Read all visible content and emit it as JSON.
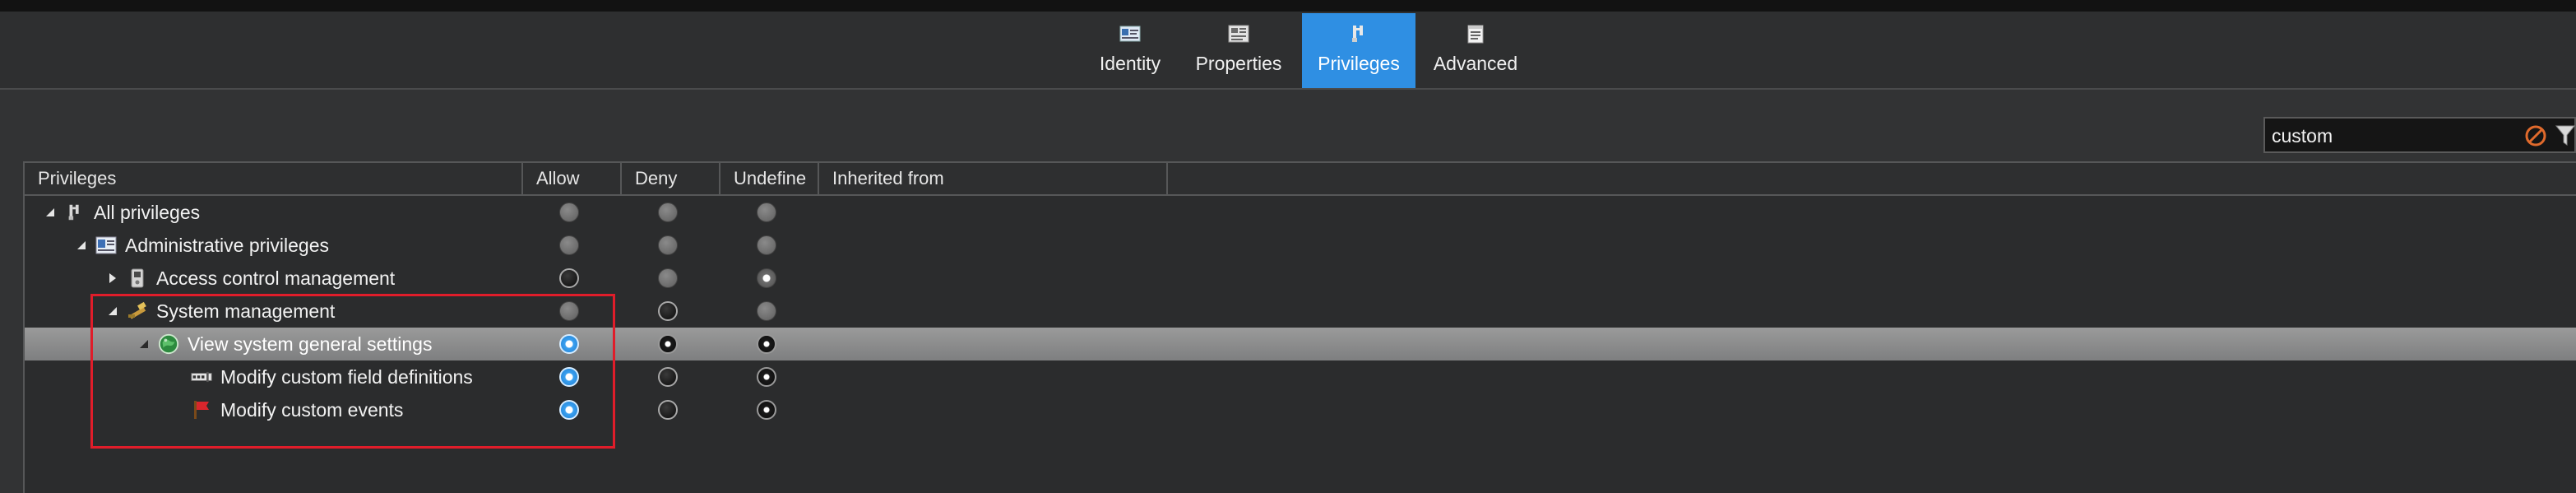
{
  "tabs": [
    {
      "label": "Identity",
      "icon": "id-card-icon",
      "active": false
    },
    {
      "label": "Properties",
      "icon": "properties-icon",
      "active": false
    },
    {
      "label": "Privileges",
      "icon": "privileges-icon",
      "active": true
    },
    {
      "label": "Advanced",
      "icon": "notepad-icon",
      "active": false
    }
  ],
  "search": {
    "value": "custom"
  },
  "columns": [
    "Privileges",
    "Allow",
    "Deny",
    "Undefine",
    "Inherited from"
  ],
  "rows": [
    {
      "label": "All privileges",
      "icon": "privileges-icon",
      "expander": "expanded",
      "allow": "grey",
      "deny": "grey",
      "undefined": "grey",
      "selected": false
    },
    {
      "label": "Administrative privileges",
      "icon": "admin-icon",
      "expander": "expanded",
      "allow": "grey",
      "deny": "grey",
      "undefined": "grey",
      "selected": false
    },
    {
      "label": "Access control management",
      "icon": "device-icon",
      "expander": "collapsed",
      "allow": "black",
      "deny": "grey",
      "undefined": "dot",
      "selected": false
    },
    {
      "label": "System management",
      "icon": "tools-icon",
      "expander": "expanded",
      "allow": "grey",
      "deny": "black",
      "undefined": "grey",
      "selected": false
    },
    {
      "label": "View system general settings",
      "icon": "globe-icon",
      "expander": "expanded",
      "allow": "checked",
      "deny": "blackdot",
      "undefined": "blackdot",
      "selected": true
    },
    {
      "label": "Modify custom field definitions",
      "icon": "field-icon",
      "expander": "none",
      "allow": "checked",
      "deny": "black",
      "undefined": "blackdot",
      "selected": false
    },
    {
      "label": "Modify custom events",
      "icon": "flag-icon",
      "expander": "none",
      "allow": "checked",
      "deny": "black",
      "undefined": "blackdot",
      "selected": false
    }
  ],
  "colors": {
    "accent": "#2f8fe3",
    "highlight": "#e01d2a",
    "background": "#323334"
  }
}
